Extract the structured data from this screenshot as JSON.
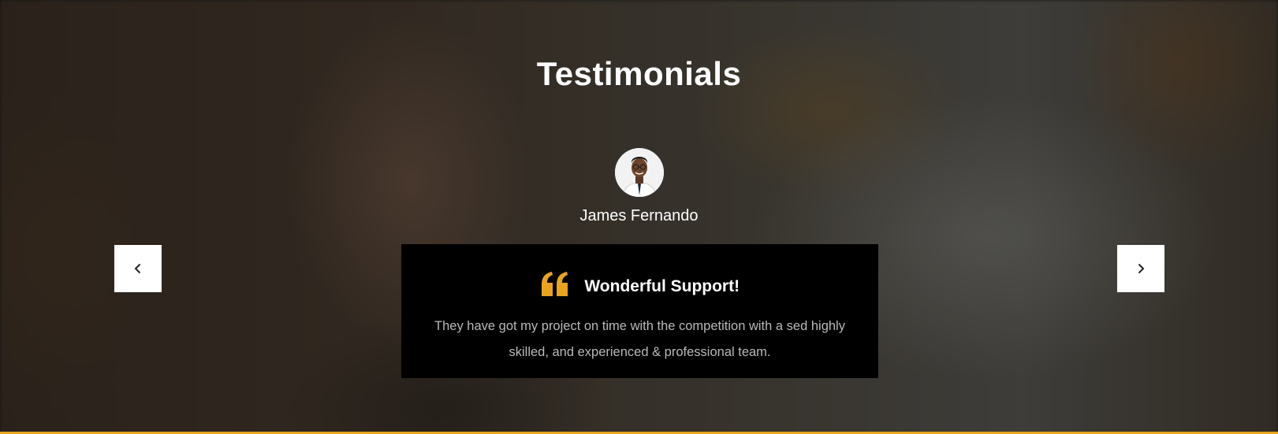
{
  "section": {
    "title": "Testimonials"
  },
  "testimonial": {
    "name": "James Fernando",
    "heading": "Wonderful Support!",
    "text": "They have got my project on time with the competition with a sed highly skilled, and experienced & professional team."
  },
  "controls": {
    "prev_icon": "chevron-left-icon",
    "next_icon": "chevron-right-icon"
  },
  "colors": {
    "accent": "#e8a41f",
    "card_bg": "#000000",
    "title_text": "#ffffff",
    "body_text": "#b9b9b9"
  }
}
